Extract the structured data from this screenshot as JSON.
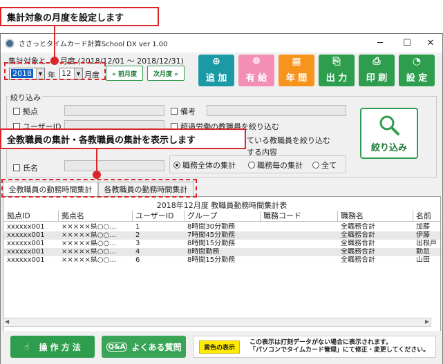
{
  "callouts": {
    "period": "集計対象の月度を設定します",
    "tabs": "全教職員の集計・各教職員の集計を表示します"
  },
  "window": {
    "title": "ささっとタイムカード計算School DX  ver 1.00"
  },
  "period": {
    "label": "集計対象と",
    "label_rest": "月度 (2018/12/01 ～ 2018/12/31)",
    "year": "2018",
    "year_unit": "年",
    "month": "12",
    "month_unit": "月度",
    "prev": "« 前月度",
    "next": "次月度 »"
  },
  "toolbar": [
    {
      "label": "追 加",
      "color": "#1b9aa6",
      "icon": "add-card-icon"
    },
    {
      "label": "有 給",
      "color": "#f38fb5",
      "icon": "paid-leave-icon"
    },
    {
      "label": "年 間",
      "color": "#f7941d",
      "icon": "calendar-icon"
    },
    {
      "label": "出 力",
      "color": "#2e9d4d",
      "icon": "export-icon"
    },
    {
      "label": "印 刷",
      "color": "#2e9d4d",
      "icon": "print-icon"
    },
    {
      "label": "設 定",
      "color": "#2e9d4d",
      "icon": "settings-icon"
    }
  ],
  "filter": {
    "title": "絞り込み",
    "site": "拠点",
    "user": "ユーザーID",
    "name": "氏名",
    "note": "備考",
    "overtime": "超過労働の教職員を絞り込む",
    "missing_partial": "ている教職員を絞り込む",
    "content_label": "する内容",
    "radio_all": "職務全体の集計",
    "radio_each": "職務毎の集計",
    "radio_total": "全て",
    "button": "絞り込み"
  },
  "tabs": {
    "all": "全教職員の勤務時間集計",
    "each": "各教職員の勤務時間集計"
  },
  "table": {
    "title": "2018年12月度 教職員勤務時間集計表",
    "columns": [
      "拠点ID",
      "拠点名",
      "ユーザーID",
      "グループ",
      "職務コード",
      "職務名",
      "名前"
    ],
    "rows": [
      [
        "xxxxxx001",
        "×××××県○○...",
        "1",
        "8時間30分勤務",
        "",
        "全職務合計",
        "加藤"
      ],
      [
        "xxxxxx001",
        "×××××県○○...",
        "2",
        "7時間45分勤務",
        "",
        "全職務合計",
        "伊藤"
      ],
      [
        "xxxxxx001",
        "×××××県○○...",
        "3",
        "8時間15分勤務",
        "",
        "全職務合計",
        "出根戸"
      ],
      [
        "xxxxxx001",
        "×××××県○○...",
        "4",
        "8時間勤務",
        "",
        "全職務合計",
        "勤怠"
      ],
      [
        "xxxxxx001",
        "×××××県○○...",
        "6",
        "8時間15分勤務",
        "",
        "全職務合計",
        "山田"
      ]
    ]
  },
  "bottom": {
    "howto": "操 作 方 法",
    "faq": "よくある質問",
    "yellow_label": "黄色の表示",
    "note_line1": "この表示は打刻データがない場合に表示されます。",
    "note_line2": "「パソコンでタイムカード管理」にて修正・変更してください。"
  }
}
